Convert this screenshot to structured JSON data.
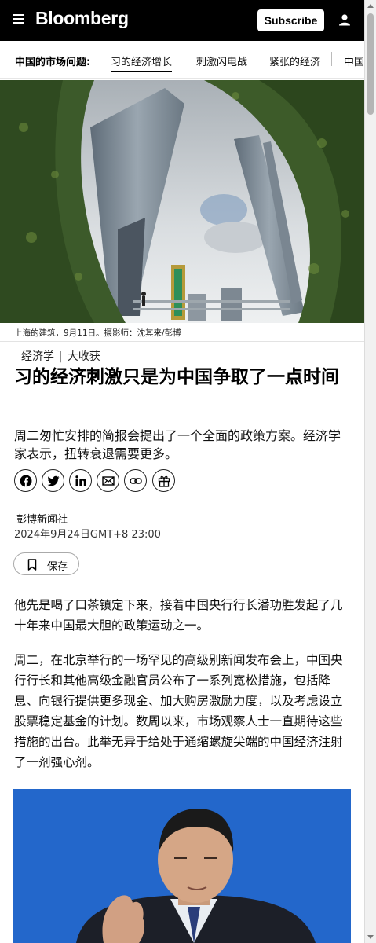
{
  "header": {
    "logo": "Bloomberg",
    "subscribe_label": "Subscribe"
  },
  "market_nav": {
    "label": "中国的市场问题:",
    "items": [
      "习的经济增长",
      "刺激闪电战",
      "紧张的经济",
      "中国"
    ]
  },
  "hero": {
    "caption": "上海的建筑，9月11日。摄影师：沈其来/彭博"
  },
  "article": {
    "kicker": [
      "经济学",
      "大收获"
    ],
    "headline": "习的经济刺激只是为中国争取了一点时间",
    "dek": "周二匆忙安排的简报会提出了一个全面的政策方案。经济学家表示，扭转衰退需要更多。",
    "source": "彭博新闻社",
    "datetime": "2024年9月24日GMT+8 23:00",
    "save_label": "保存",
    "paragraphs": [
      "他先是喝了口茶镇定下来，接着中国央行行长潘功胜发起了几十年来中国最大胆的政策运动之一。",
      "周二，在北京举行的一场罕见的高级别新闻发布会上，中国央行行长和其他高级金融官员公布了一系列宽松措施，包括降息、向银行提供更多现金、加大购房激励力度，以及考虑设立股票稳定基金的计划。数周以来，市场观察人士一直期待这些措施的出台。此举无异于给处于通缩螺旋尖端的中国经济注射了一剂强心剂。"
    ]
  },
  "share_icons": [
    "facebook-icon",
    "twitter-icon",
    "linkedin-icon",
    "email-icon",
    "link-icon",
    "gift-icon"
  ],
  "colors": {
    "header_bg": "#000000",
    "photo2_bg": "#1f63c7"
  }
}
